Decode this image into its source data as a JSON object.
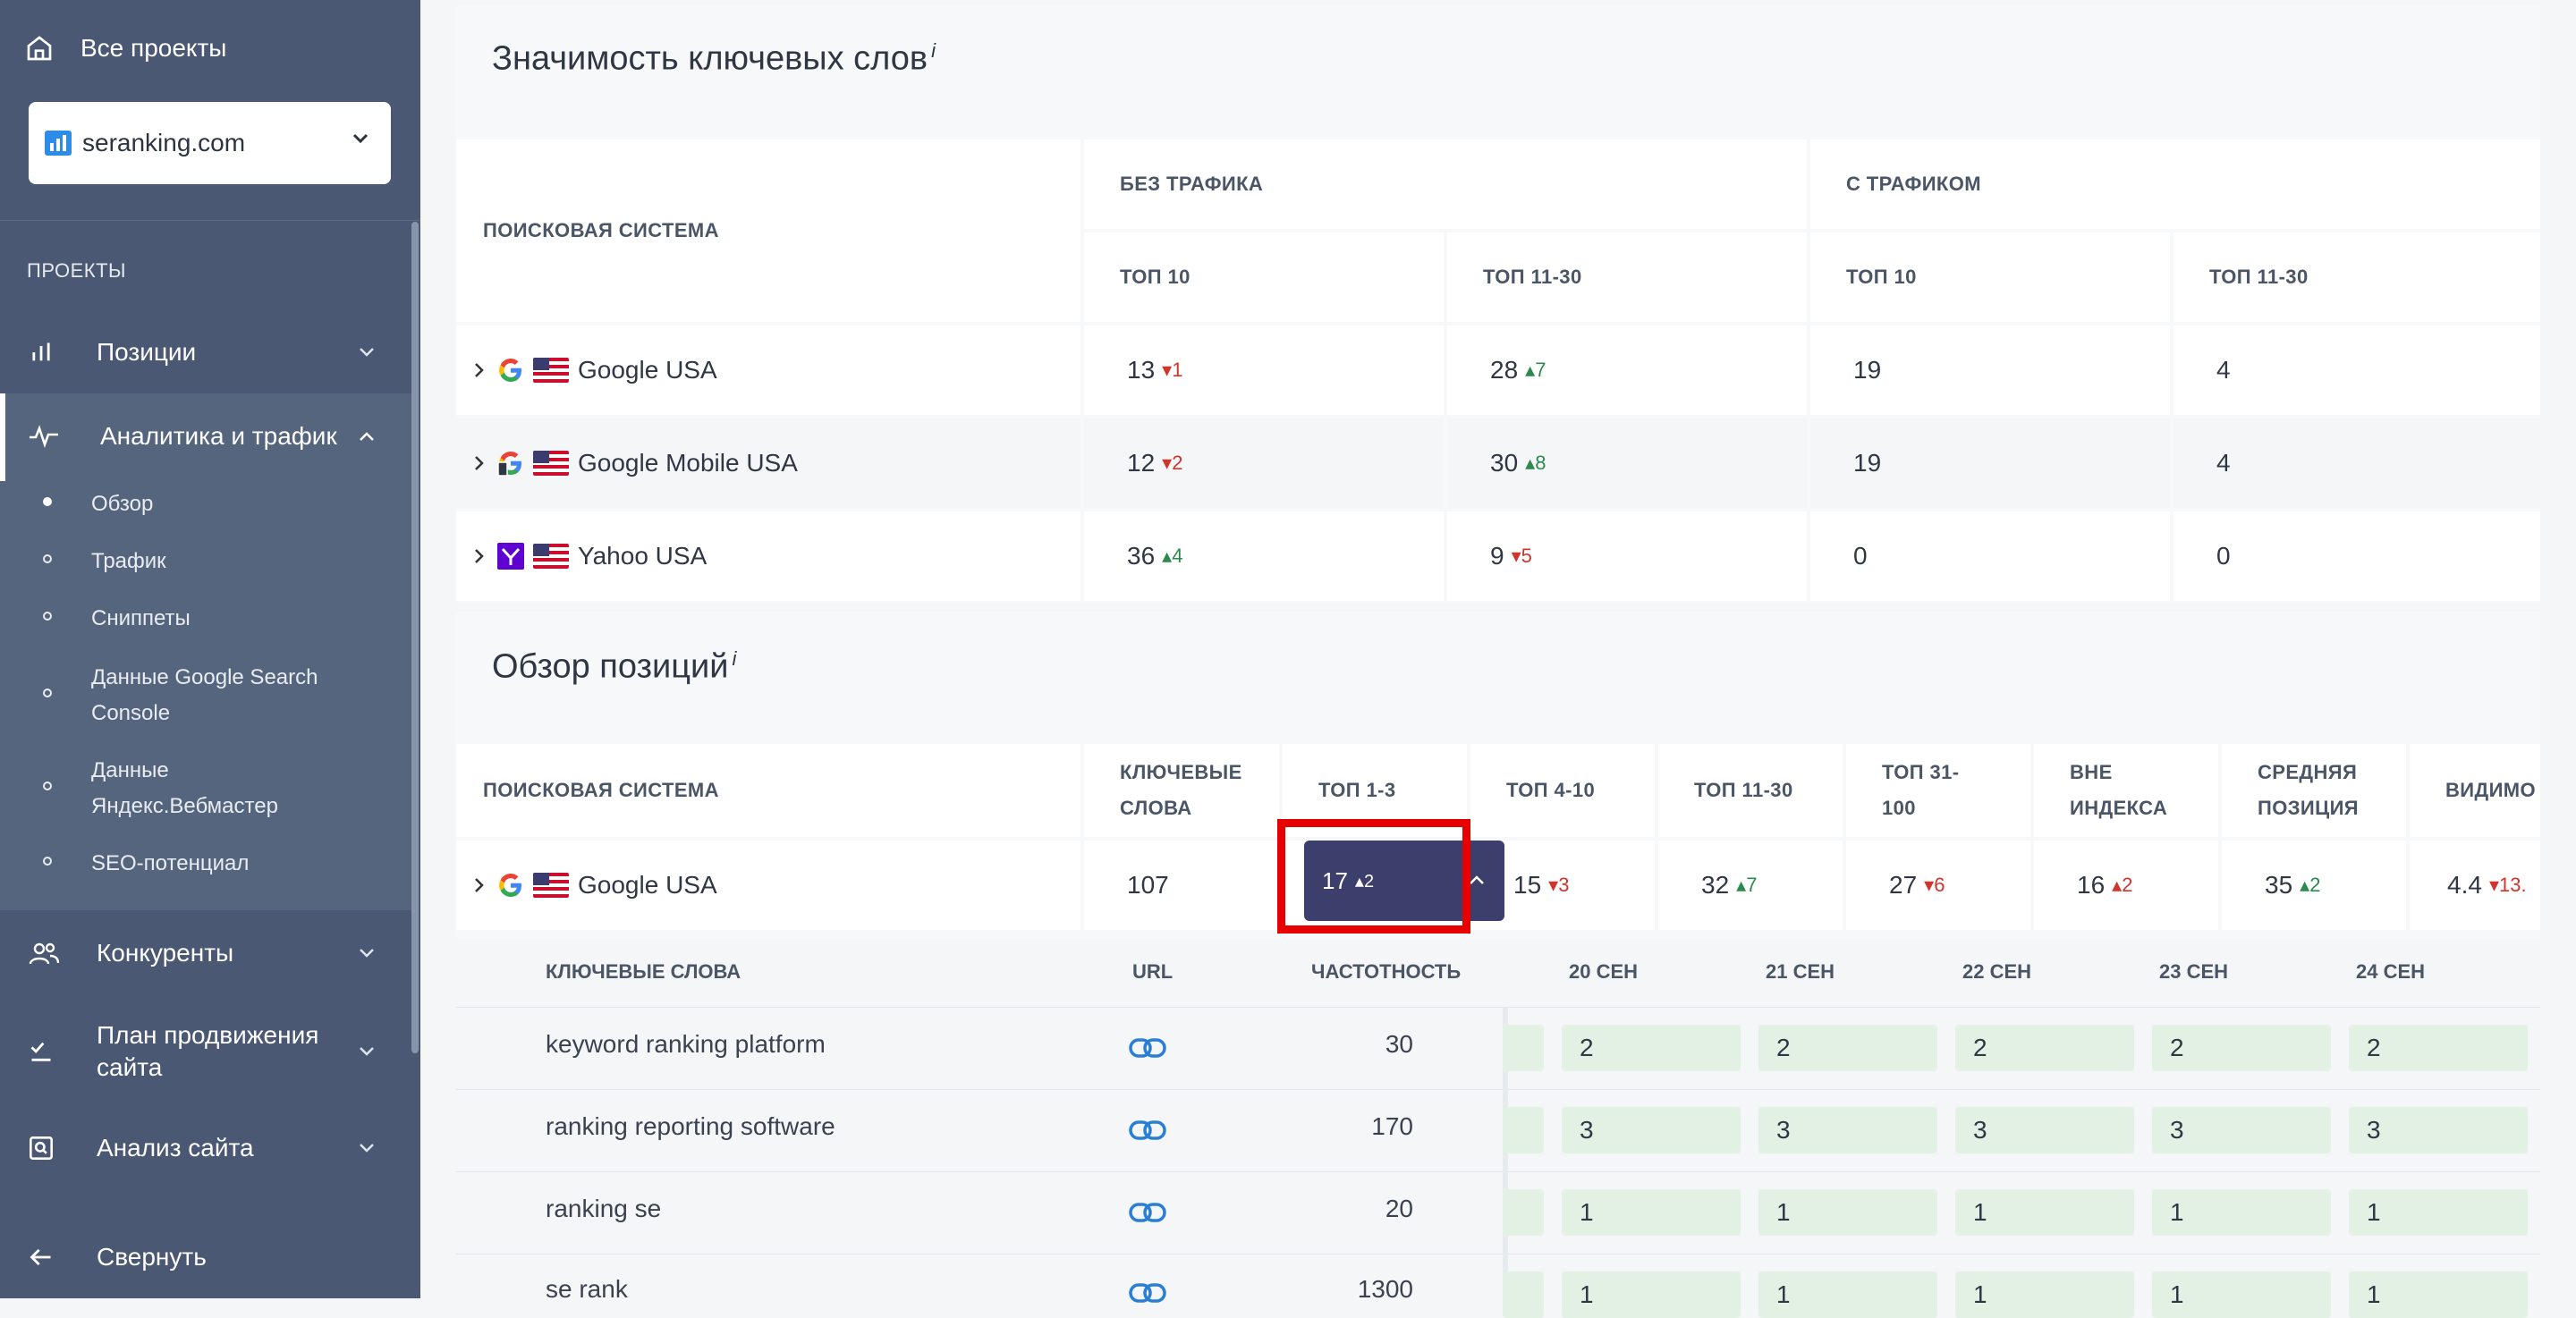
{
  "sidebar": {
    "home_label": "Все проекты",
    "project": "seranking.com",
    "section_label": "ПРОЕКТЫ",
    "items": {
      "positions": "Позиции",
      "analytics": "Аналитика и трафик",
      "competitors": "Конкуренты",
      "plan": "План продвижения сайта",
      "audit": "Анализ сайта",
      "collapse": "Свернуть"
    },
    "subitems": [
      "Обзор",
      "Трафик",
      "Сниппеты",
      "Данные Google Search Console",
      "Данные Яндекс.Вебмастер",
      "SEO-потенциал"
    ]
  },
  "keywords_card": {
    "title": "Значимость ключевых слов",
    "info": "i",
    "headers": {
      "se": "ПОИСКОВАЯ СИСТЕМА",
      "no_traffic": "БЕЗ ТРАФИКА",
      "with_traffic": "С ТРАФИКОМ",
      "top10": "ТОП 10",
      "top11_30": "ТОП 11-30"
    },
    "rows": [
      {
        "se": "Google USA",
        "nt10": "13",
        "nt10_d": "1",
        "nt11": "28",
        "nt11_d": "7",
        "wt10": "19",
        "wt11": "4"
      },
      {
        "se": "Google Mobile USA",
        "nt10": "12",
        "nt10_d": "2",
        "nt11": "30",
        "nt11_d": "8",
        "wt10": "19",
        "wt11": "4"
      },
      {
        "se": "Yahoo USA",
        "nt10": "36",
        "nt10_d": "4",
        "nt11": "9",
        "nt11_d": "5",
        "wt10": "0",
        "wt11": "0"
      }
    ]
  },
  "positions_card": {
    "title": "Обзор позиций",
    "info": "i",
    "headers": {
      "se": "ПОИСКОВАЯ СИСТЕМА",
      "keywords_1": "КЛЮЧЕВЫЕ",
      "keywords_2": "СЛОВА",
      "top1_3": "ТОП 1-3",
      "top4_10": "ТОП 4-10",
      "top11_30": "ТОП 11-30",
      "top31_1": "ТОП 31-",
      "top31_2": "100",
      "out_1": "ВНЕ",
      "out_2": "ИНДЕКСА",
      "avg_1": "СРЕДНЯЯ",
      "avg_2": "ПОЗИЦИЯ",
      "vis": "ВИДИМО"
    },
    "row": {
      "se": "Google USA",
      "keywords": "107",
      "top1_3": "17",
      "top1_3_d": "2",
      "top4_10": "15",
      "top4_10_d": "3",
      "top11_30": "32",
      "top11_30_d": "7",
      "top31": "27",
      "top31_d": "6",
      "out": "16",
      "out_d": "2",
      "avg": "35",
      "avg_d": "2",
      "vis": "4.4",
      "vis_d": "13."
    }
  },
  "detail": {
    "headers": {
      "keyword": "КЛЮЧЕВЫЕ СЛОВА",
      "url": "URL",
      "freq": "ЧАСТОТНОСТЬ",
      "d1": "20 СЕН",
      "d2": "21 СЕН",
      "d3": "22 СЕН",
      "d4": "23 СЕН",
      "d5": "24 СЕН"
    },
    "rows": [
      {
        "kw": "keyword ranking platform",
        "freq": "30",
        "r": [
          "2",
          "2",
          "2",
          "2",
          "2"
        ]
      },
      {
        "kw": "ranking reporting software",
        "freq": "170",
        "r": [
          "3",
          "3",
          "3",
          "3",
          "3"
        ]
      },
      {
        "kw": "ranking se",
        "freq": "20",
        "r": [
          "1",
          "1",
          "1",
          "1",
          "1"
        ]
      },
      {
        "kw": "se rank",
        "freq": "1300",
        "r": [
          "1",
          "1",
          "1",
          "1",
          "1"
        ]
      }
    ]
  },
  "colors": {
    "sidebar": "#4a5873",
    "pill": "#3c3e6b",
    "highlight": "#e60000",
    "up": "#2c8a4e",
    "down": "#d0342c",
    "rank_bg": "#e3f1e5"
  }
}
